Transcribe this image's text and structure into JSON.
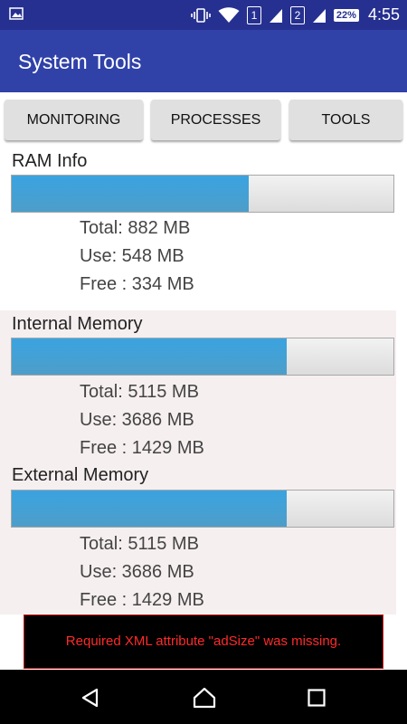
{
  "status_bar": {
    "time": "4:55",
    "battery": "22%",
    "sim1": "1",
    "sim2": "2",
    "icons": [
      "image-icon",
      "vibrate-icon",
      "wifi-icon",
      "signal-icon",
      "battery-icon"
    ]
  },
  "app": {
    "title": "System Tools"
  },
  "tabs": [
    {
      "label": "MONITORING"
    },
    {
      "label": "PROCESSES"
    },
    {
      "label": "TOOLS"
    }
  ],
  "sections": {
    "ram": {
      "title": "RAM Info",
      "used_fraction": 0.621,
      "total": "Total: 882 MB",
      "use": "Use: 548 MB",
      "free": "Free : 334 MB"
    },
    "internal": {
      "title": "Internal Memory",
      "used_fraction": 0.721,
      "total": "Total: 5115 MB",
      "use": "Use: 3686 MB",
      "free": "Free : 1429 MB"
    },
    "external": {
      "title": "External Memory",
      "used_fraction": 0.721,
      "total": "Total: 5115 MB",
      "use": "Use: 3686 MB",
      "free": "Free : 1429 MB"
    }
  },
  "ad": {
    "error_text": "Required XML attribute \"adSize\" was missing."
  },
  "nav": {
    "icons": [
      "back-icon",
      "home-icon",
      "recents-icon"
    ]
  },
  "colors": {
    "app_bar": "#3041a8",
    "status_bar": "#263090",
    "bar_fill": "#3aa3e0",
    "error_text": "#ff2a2a"
  }
}
